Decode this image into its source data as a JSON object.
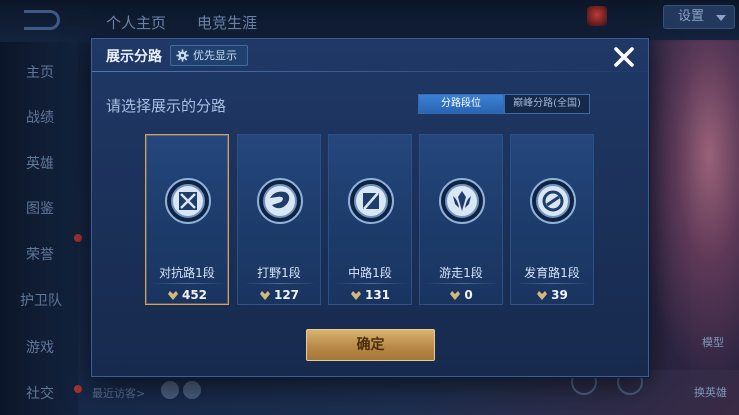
{
  "background": {
    "top_tabs": [
      "个人主页",
      "电竞生涯"
    ],
    "settings_label": "设置",
    "sidebar_items": [
      "主页",
      "战绩",
      "英雄",
      "图鉴",
      "荣誉",
      "护卫队",
      "游戏",
      "社交"
    ],
    "recent_visits_label": "最近访客>",
    "right_labels": [
      "模型",
      "换英雄"
    ]
  },
  "modal": {
    "title": "展示分路",
    "priority_label": "优先显示",
    "prompt": "请选择展示的分路",
    "segments": [
      {
        "label": "分路段位",
        "active": true
      },
      {
        "label": "巅峰分路(全国)",
        "active": false
      }
    ],
    "cards": [
      {
        "label": "对抗路1段",
        "points": "452",
        "selected": true,
        "icon": "clash-lane-icon"
      },
      {
        "label": "打野1段",
        "points": "127",
        "selected": false,
        "icon": "jungle-icon"
      },
      {
        "label": "中路1段",
        "points": "131",
        "selected": false,
        "icon": "mid-lane-icon"
      },
      {
        "label": "游走1段",
        "points": "0",
        "selected": false,
        "icon": "roam-icon"
      },
      {
        "label": "发育路1段",
        "points": "39",
        "selected": false,
        "icon": "farm-lane-icon"
      }
    ],
    "confirm_label": "确定"
  },
  "colors": {
    "modal_bg": "#1f3866",
    "accent_blue": "#3a82d4",
    "selected_border": "#d5a162",
    "confirm_gold": "#c99a55"
  }
}
